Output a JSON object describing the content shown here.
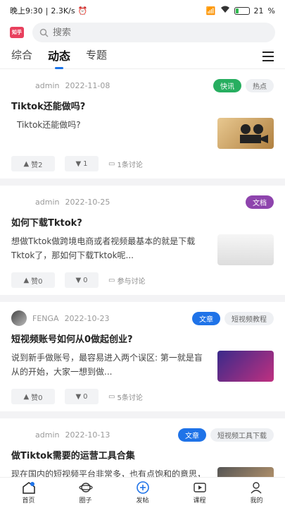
{
  "status_bar": {
    "time": "晚上9:30",
    "speed": "2.3K/s",
    "battery": "21",
    "battery_level": 0.21
  },
  "header": {
    "logo_text": "知乎",
    "search_placeholder": "搜索"
  },
  "tabs": [
    {
      "label": "综合",
      "active": false
    },
    {
      "label": "动态",
      "active": true
    },
    {
      "label": "专题",
      "active": false
    }
  ],
  "posts": [
    {
      "author": "admin",
      "date": "2022-11-08",
      "tags": [
        "快讯",
        "热点"
      ],
      "title": "Tiktok还能做吗?",
      "excerpt": "Tiktok还能做吗?",
      "likes": "赞2",
      "dislikes": "1",
      "comments": "1条讨论"
    },
    {
      "author": "admin",
      "date": "2022-10-25",
      "tags": [
        "文档"
      ],
      "title": "如何下载Tktok?",
      "excerpt": "想做Tktok做跨境电商或者视频最基本的就是下载Tktok了，那如何下载Tktok呢...",
      "likes": "赞0",
      "dislikes": "0",
      "comments": "参与讨论"
    },
    {
      "author": "FENGA",
      "date": "2022-10-23",
      "tags": [
        "文章",
        "短视频教程"
      ],
      "title": "短视频账号如何从0做起创业?",
      "excerpt": "说到新手做账号，最容易进入两个误区: 第一就是盲从的开始，大家一想到做...",
      "likes": "赞0",
      "dislikes": "0",
      "comments": "5条讨论"
    },
    {
      "author": "admin",
      "date": "2022-10-13",
      "tags": [
        "文章",
        "短视频工具下载"
      ],
      "title": "做Tiktok需要的运营工具合集",
      "excerpt": "现在国内的短视频平台非常多，也有点饱和的意思，那做国外的Tiktok如何? 想在..."
    }
  ],
  "bottom_nav": [
    {
      "label": "首页",
      "icon": "home-icon"
    },
    {
      "label": "圈子",
      "icon": "planet-icon"
    },
    {
      "label": "发帖",
      "icon": "add-circle-icon"
    },
    {
      "label": "课程",
      "icon": "video-icon"
    },
    {
      "label": "我的",
      "icon": "user-icon"
    }
  ],
  "colors": {
    "accent": "#1f73e8",
    "green_tag": "#27ae60",
    "purple_tag": "#8e44ad",
    "logo": "#e8405d"
  }
}
